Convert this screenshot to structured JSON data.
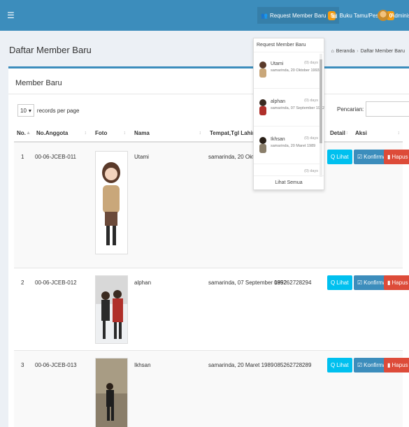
{
  "topbar": {
    "menu_icon": "hamburger-icon",
    "request_label": "Request Member Baru",
    "request_count": "5",
    "buku_label": "Buku Tamu/Pesan",
    "buku_count": "0",
    "admin_label": "Administrator"
  },
  "header": {
    "title": "Daftar Member Baru",
    "breadcrumb": [
      "Beranda",
      "Daftar Member Baru"
    ]
  },
  "box": {
    "title": "Member Baru",
    "records_value": "10",
    "records_label": "records per page",
    "search_label": "Pencarian:",
    "search_value": ""
  },
  "table": {
    "columns": [
      "No.",
      "No.Anggota",
      "Foto",
      "Nama",
      "Tempat,Tgl Lahir",
      "",
      "Detail",
      "Aksi"
    ],
    "rows": [
      {
        "no": "1",
        "anggota": "00-06-JCEB-011",
        "nama": "Utami",
        "ttl": "samarinda, 20 Oktober 1993",
        "telp": ""
      },
      {
        "no": "2",
        "anggota": "00-06-JCEB-012",
        "nama": "alphan",
        "ttl": "samarinda, 07 September 1992",
        "telp": "085262728294"
      },
      {
        "no": "3",
        "anggota": "00-06-JCEB-013",
        "nama": "Ikhsan",
        "ttl": "samarinda, 20 Maret 1989",
        "telp": "085262728289"
      }
    ],
    "btn_lihat": "Lihat",
    "btn_konfirmasi": "Konfirmasi",
    "btn_hapus": "Hapus"
  },
  "dropdown": {
    "header": "Request Member Baru",
    "items": [
      {
        "name": "Utami",
        "sub": "samarinda, 20 Oktober 1993",
        "time": "(0) days"
      },
      {
        "name": "alphan",
        "sub": "samarinda, 07 September 1992",
        "time": "(0) days"
      },
      {
        "name": "Ikhsan",
        "sub": "samarinda, 20 Maret 1989",
        "time": "(0) days"
      },
      {
        "name": "",
        "sub": "",
        "time": "(0) days"
      }
    ],
    "footer": "Lihat Semua"
  },
  "colors": {
    "primary": "#3c8dbc",
    "info": "#00c0ef",
    "danger": "#dd4b39",
    "warning": "#f39c12"
  }
}
